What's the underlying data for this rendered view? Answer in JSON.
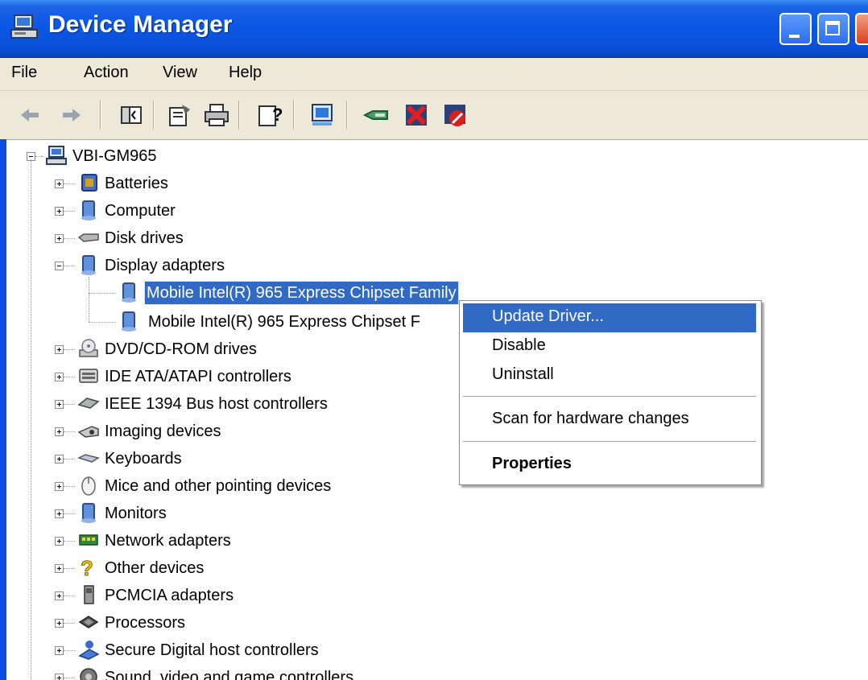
{
  "window": {
    "title": "Device Manager"
  },
  "menu": [
    "File",
    "Action",
    "View",
    "Help"
  ],
  "toolbar_icons": [
    "back-arrow-icon",
    "forward-arrow-icon",
    "show-hide-tree-icon",
    "properties-icon",
    "print-icon",
    "help-icon",
    "scan-hardware-icon",
    "update-driver-icon",
    "uninstall-icon",
    "disable-icon"
  ],
  "tree": {
    "root": "VBI-GM965",
    "categories": [
      {
        "label": "Batteries",
        "icon": "battery-icon",
        "expanded": false
      },
      {
        "label": "Computer",
        "icon": "computer-icon",
        "expanded": false
      },
      {
        "label": "Disk drives",
        "icon": "disk-drive-icon",
        "expanded": false
      },
      {
        "label": "Display adapters",
        "icon": "display-adapter-icon",
        "expanded": true,
        "children": [
          "Mobile Intel(R) 965 Express Chipset Family",
          "Mobile Intel(R) 965 Express Chipset F"
        ]
      },
      {
        "label": "DVD/CD-ROM drives",
        "icon": "dvd-drive-icon",
        "expanded": false
      },
      {
        "label": "IDE ATA/ATAPI controllers",
        "icon": "ide-controller-icon",
        "expanded": false
      },
      {
        "label": "IEEE 1394 Bus host controllers",
        "icon": "ieee1394-icon",
        "expanded": false
      },
      {
        "label": "Imaging devices",
        "icon": "camera-icon",
        "expanded": false
      },
      {
        "label": "Keyboards",
        "icon": "keyboard-icon",
        "expanded": false
      },
      {
        "label": "Mice and other pointing devices",
        "icon": "mouse-icon",
        "expanded": false
      },
      {
        "label": "Monitors",
        "icon": "monitor-icon",
        "expanded": false
      },
      {
        "label": "Network adapters",
        "icon": "network-adapter-icon",
        "expanded": false
      },
      {
        "label": "Other devices",
        "icon": "question-mark-icon",
        "expanded": false
      },
      {
        "label": "PCMCIA adapters",
        "icon": "pcmcia-icon",
        "expanded": false
      },
      {
        "label": "Processors",
        "icon": "processor-icon",
        "expanded": false
      },
      {
        "label": "Secure Digital host controllers",
        "icon": "sd-controller-icon",
        "expanded": false
      },
      {
        "label": "Sound, video and game controllers",
        "icon": "sound-icon",
        "expanded": false
      }
    ]
  },
  "context_menu": {
    "items": [
      "Update Driver...",
      "Disable",
      "Uninstall",
      "Scan for hardware changes",
      "Properties"
    ],
    "highlighted": "Update Driver..."
  },
  "colors": {
    "titlebar": "#0a56e4",
    "selection": "#316ac5",
    "chrome": "#ece9d8"
  }
}
